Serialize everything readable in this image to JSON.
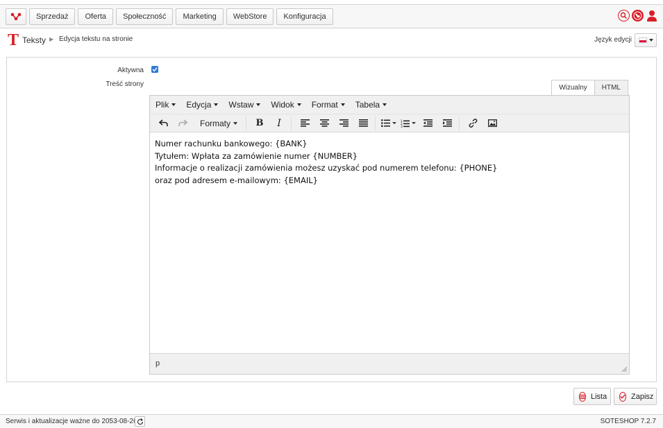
{
  "nav": {
    "items": [
      "Sprzedaż",
      "Oferta",
      "Społeczność",
      "Marketing",
      "WebStore",
      "Konfiguracja"
    ]
  },
  "breadcrumb": {
    "title": "Teksty",
    "sub": "Edycja tekstu na stronie"
  },
  "lang": {
    "label": "Język edycji"
  },
  "form": {
    "active_label": "Aktywna",
    "active_checked": true,
    "content_label": "Treść strony"
  },
  "tabs": [
    "Wizualny",
    "HTML"
  ],
  "editor": {
    "menu": [
      "Plik",
      "Edycja",
      "Wstaw",
      "Widok",
      "Format",
      "Tabela"
    ],
    "formats_label": "Formaty",
    "content_lines": [
      "Numer rachunku bankowego: {BANK}",
      "Tytułem: Wpłata za zamówienie numer {NUMBER}",
      "Informacje o realizacji zamówienia możesz uzyskać pod numerem telefonu: {PHONE}",
      "oraz pod adresem e-mailowym: {EMAIL}"
    ],
    "path": "p"
  },
  "actions": {
    "list_label": "Lista",
    "save_label": "Zapisz"
  },
  "footer": {
    "service_text": "Serwis i aktualizacje ważne do 2053-08-26",
    "version": "SOTESHOP 7.2.7"
  },
  "colors": {
    "brand_red": "#d91c26",
    "checkbox_blue": "#2e7bd6"
  }
}
